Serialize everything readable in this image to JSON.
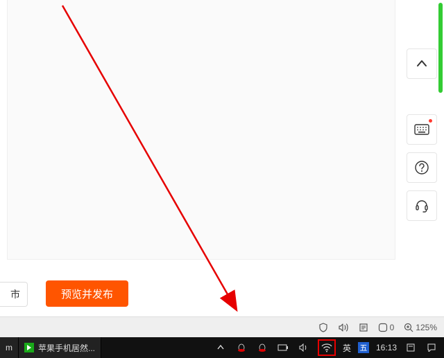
{
  "content": {
    "partial_button_visible_text": "市",
    "publish_button_label": "预览并发布"
  },
  "side_tools": {
    "up_label": "scroll-top",
    "keyboard_label": "keyboard",
    "help_label": "help",
    "headset_label": "support"
  },
  "browser_status": {
    "shield_icon": "shield",
    "speaker_icon": "speaker",
    "reader_icon": "reader",
    "badge_value": "0",
    "zoom_label": "125%"
  },
  "taskbar": {
    "left_partial_app_suffix": "m",
    "browser_tab_title": "苹果手机居然...",
    "ime_lang": "英",
    "ime_mode": "五",
    "clock": "16:13"
  },
  "annotation": {
    "color": "#e60000"
  }
}
